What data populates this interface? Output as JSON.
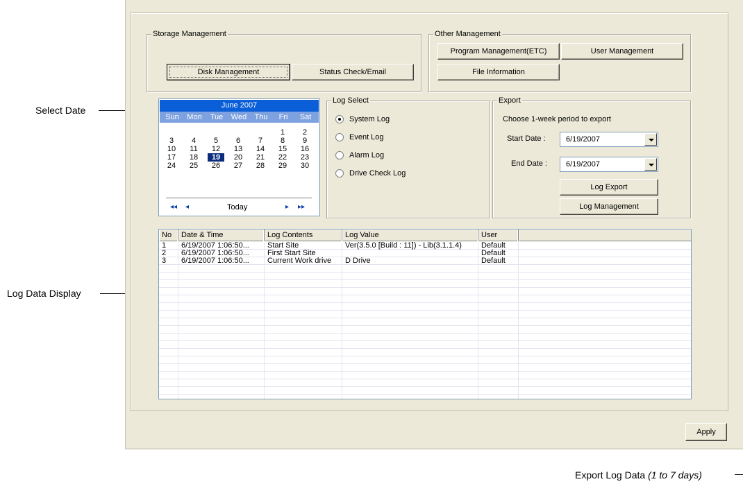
{
  "annotations": {
    "select_date": "Select Date",
    "log_data_display": "Log Data Display",
    "export_log_prefix": "Export Log Data",
    "export_log_suffix": "(1 to 7 days)"
  },
  "storage_management": {
    "title": "Storage Management",
    "disk_button": "Disk Management",
    "status_button": "Status Check/Email"
  },
  "other_management": {
    "title": "Other Management",
    "program_button": "Program Management(ETC)",
    "user_button": "User Management",
    "file_button": "File Information"
  },
  "calendar": {
    "month_label": "June 2007",
    "weekdays": [
      "Sun",
      "Mon",
      "Tue",
      "Wed",
      "Thu",
      "Fri",
      "Sat"
    ],
    "weeks": [
      [
        "",
        "",
        "",
        "",
        "",
        "1",
        "2"
      ],
      [
        "3",
        "4",
        "5",
        "6",
        "7",
        "8",
        "9"
      ],
      [
        "10",
        "11",
        "12",
        "13",
        "14",
        "15",
        "16"
      ],
      [
        "17",
        "18",
        "19",
        "20",
        "21",
        "22",
        "23"
      ],
      [
        "24",
        "25",
        "26",
        "27",
        "28",
        "29",
        "30"
      ]
    ],
    "selected_day": "19",
    "nav_first": "◂◂",
    "nav_prev": "◂",
    "today_label": "Today",
    "nav_next": "▸",
    "nav_last": "▸▸"
  },
  "log_select": {
    "title": "Log Select",
    "options": [
      {
        "label": "System Log",
        "checked": true
      },
      {
        "label": "Event Log",
        "checked": false
      },
      {
        "label": "Alarm Log",
        "checked": false
      },
      {
        "label": "Drive Check Log",
        "checked": false
      }
    ]
  },
  "export": {
    "title": "Export",
    "instruction": "Choose 1-week period to export",
    "start_label": "Start Date :",
    "start_value": "6/19/2007",
    "end_label": "End Date :",
    "end_value": "6/19/2007",
    "export_button": "Log Export",
    "management_button": "Log Management"
  },
  "log_table": {
    "columns": [
      "No",
      "Date & Time",
      "Log Contents",
      "Log Value",
      "User",
      ""
    ],
    "rows": [
      [
        "1",
        "6/19/2007 1:06:50...",
        "Start Site",
        "Ver(3.5.0 [Build : 11])  - Lib(3.1.1.4)",
        "Default"
      ],
      [
        "2",
        "6/19/2007 1:06:50...",
        "First Start Site",
        "",
        "Default"
      ],
      [
        "3",
        "6/19/2007 1:06:50...",
        "Current Work drive",
        "D Drive",
        "Default"
      ]
    ]
  },
  "apply_button": "Apply"
}
